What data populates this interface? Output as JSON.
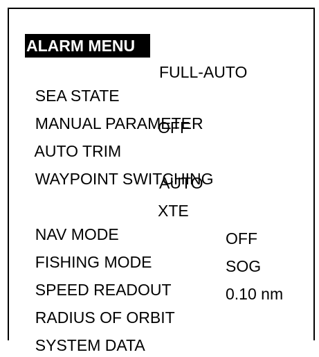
{
  "menu": {
    "title": "ALARM MENU",
    "items": [
      {
        "label": "SEA STATE",
        "value": "FULL-AUTO"
      },
      {
        "label": "MANUAL PARAMETER",
        "value": ""
      },
      {
        "label": "AUTO TRIM",
        "value": "OFF"
      },
      {
        "label": "WAYPOINT SWITCHING",
        "value": ""
      },
      {
        "label": "",
        "value": "AUTO"
      },
      {
        "label": "NAV MODE",
        "value": "XTE"
      },
      {
        "label": "FISHING MODE",
        "value": "OFF"
      },
      {
        "label": "SPEED READOUT",
        "value": "SOG"
      },
      {
        "label": "RADIUS OF ORBIT",
        "value": "0.10 nm"
      },
      {
        "label": "SYSTEM DATA",
        "value": ""
      }
    ]
  }
}
